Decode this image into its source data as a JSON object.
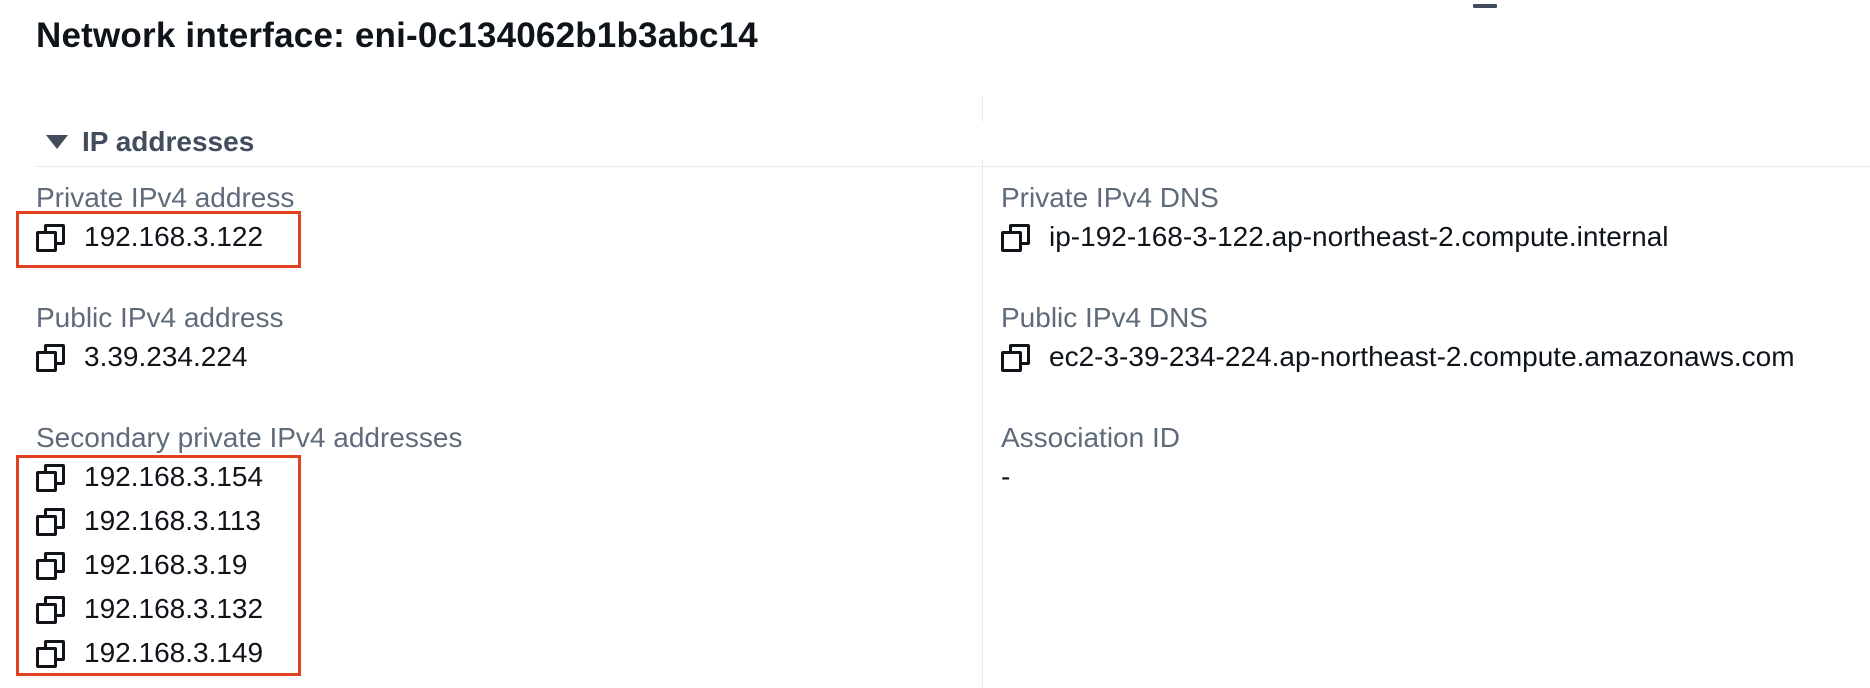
{
  "title": "Network interface: eni-0c134062b1b3abc14",
  "section": {
    "title": "IP addresses",
    "expanded": true
  },
  "fields": {
    "private_ipv4_address": {
      "label": "Private IPv4 address",
      "value": "192.168.3.122"
    },
    "public_ipv4_address": {
      "label": "Public IPv4 address",
      "value": "3.39.234.224"
    },
    "secondary_private_ipv4_addresses": {
      "label": "Secondary private IPv4 addresses",
      "values": [
        "192.168.3.154",
        "192.168.3.113",
        "192.168.3.19",
        "192.168.3.132",
        "192.168.3.149"
      ]
    },
    "private_ipv4_dns": {
      "label": "Private IPv4 DNS",
      "value": "ip-192-168-3-122.ap-northeast-2.compute.internal"
    },
    "public_ipv4_dns": {
      "label": "Public IPv4 DNS",
      "value": "ec2-3-39-234-224.ap-northeast-2.compute.amazonaws.com"
    },
    "association_id": {
      "label": "Association ID",
      "value": "-"
    }
  },
  "icons": {
    "copy": "copy-icon",
    "expand": "caret-down-icon"
  },
  "colors": {
    "highlight": "#e0421f",
    "label": "#5f6b7a",
    "text": "#0f141a",
    "divider": "#e9ebed"
  }
}
